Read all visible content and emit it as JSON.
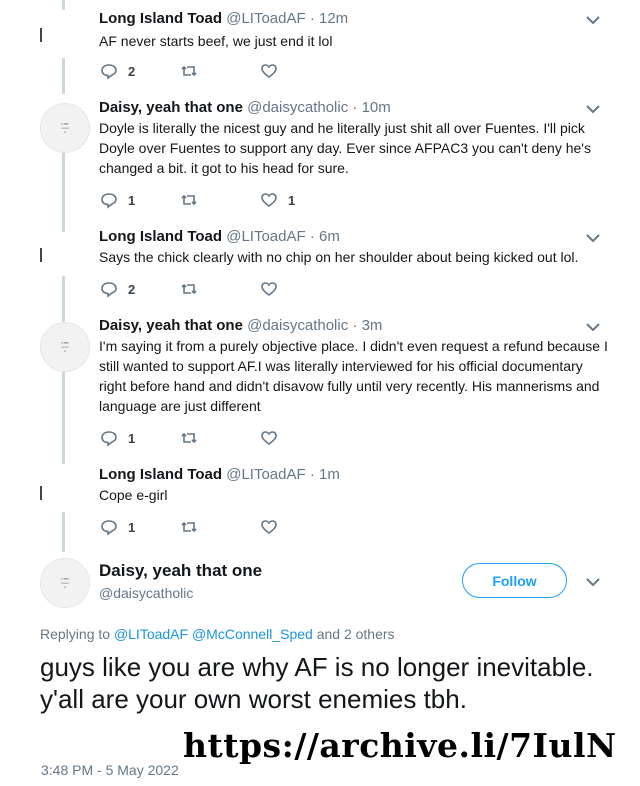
{
  "tweets": [
    {
      "name": "Long Island Toad",
      "handle": "@LIToadAF",
      "dot": "·",
      "time": "12m",
      "text": "AF never starts beef, we just end it lol",
      "reply_count": "2",
      "retweet_count": "",
      "like_count": ""
    },
    {
      "name": "Daisy, yeah that one",
      "handle": "@daisycatholic",
      "dot": "·",
      "time": "10m",
      "text": "Doyle is literally the nicest guy and he literally just shit all over Fuentes. I'll pick Doyle over Fuentes to support any day. Ever since AFPAC3 you can't deny he's changed a bit. it got to his head for sure.",
      "reply_count": "1",
      "retweet_count": "",
      "like_count": "1"
    },
    {
      "name": "Long Island Toad",
      "handle": "@LIToadAF",
      "dot": "·",
      "time": "6m",
      "text": "Says the chick clearly with no chip on her shoulder about being kicked out lol.",
      "reply_count": "2",
      "retweet_count": "",
      "like_count": ""
    },
    {
      "name": "Daisy, yeah that one",
      "handle": "@daisycatholic",
      "dot": "·",
      "time": "3m",
      "text": "I'm saying it from a purely objective place. I didn't even request a refund because I still wanted to support AF.I was literally interviewed for his official documentary right before hand and didn't disavow fully until very recently. His mannerisms and language are just different",
      "reply_count": "1",
      "retweet_count": "",
      "like_count": ""
    },
    {
      "name": "Long Island Toad",
      "handle": "@LIToadAF",
      "dot": "·",
      "time": "1m",
      "text": "Cope e-girl",
      "reply_count": "1",
      "retweet_count": "",
      "like_count": ""
    }
  ],
  "main_tweet": {
    "name": "Daisy, yeah that one",
    "handle": "@daisycatholic",
    "follow_label": "Follow",
    "replying_prefix": "Replying to",
    "reply_handle_1": "@LIToadAF",
    "reply_handle_2": "@McConnell_Sped",
    "replying_suffix": "and 2 others",
    "text": "guys like you are why AF is no longer inevitable. y'all are your own worst enemies tbh.",
    "timestamp": "3:48 PM - 5 May 2022"
  },
  "watermark": "https://archive.li/7IulN",
  "colors": {
    "link": "#1b95e0",
    "follow": "#1da1f2",
    "muted": "#657786",
    "rail": "#ccd6dd"
  },
  "icons": [
    "reply-icon",
    "retweet-icon",
    "like-icon",
    "chevron-down-icon"
  ]
}
